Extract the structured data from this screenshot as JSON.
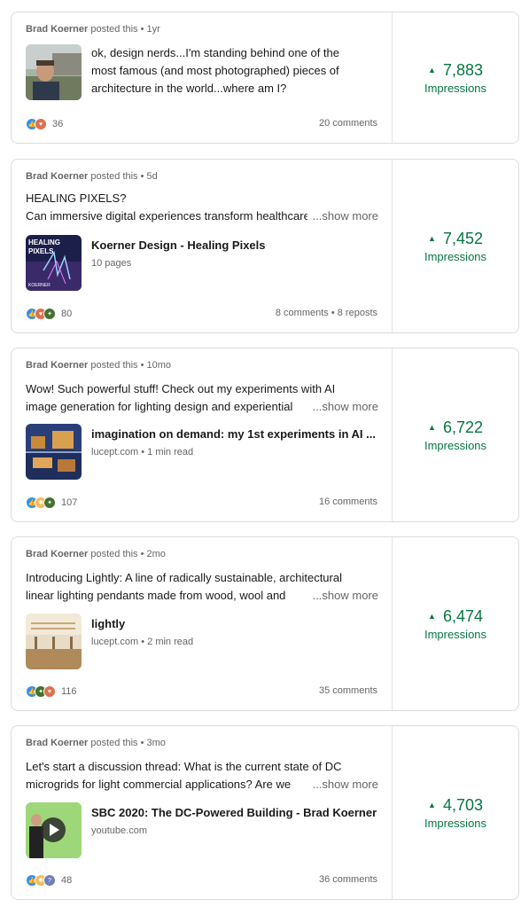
{
  "posts": [
    {
      "author": "Brad Koerner",
      "posted": "posted this • 1yr",
      "lines": [
        "ok, design nerds...I'm standing behind one of the",
        "most famous (and most photographed) pieces of",
        "architecture in the world...where am I?"
      ],
      "reactions": [
        "like",
        "love"
      ],
      "reaction_count": "36",
      "stats": "20 comments",
      "impressions": "7,883",
      "impressions_label": "Impressions"
    },
    {
      "author": "Brad Koerner",
      "posted": "posted this • 5d",
      "line1": "HEALING PIXELS?",
      "line2": "Can immersive digital experiences transform healthcare",
      "show_more": "...show more",
      "thumb_text": [
        "HEALING",
        "PIXELS",
        "KOERNER"
      ],
      "attachment_title": "Koerner Design - Healing Pixels",
      "attachment_sub": "10 pages",
      "reactions": [
        "like",
        "love",
        "celebrate"
      ],
      "reaction_count": "80",
      "stats": "8 comments • 8 reposts",
      "impressions": "7,452",
      "impressions_label": "Impressions"
    },
    {
      "author": "Brad Koerner",
      "posted": "posted this • 10mo",
      "line1": "Wow! Such powerful stuff! Check out my experiments with AI",
      "line2": "image generation for lighting design and experiential",
      "show_more": "...show more",
      "attachment_title": "imagination on demand: my 1st experiments in AI ...",
      "attachment_sub": "lucept.com • 1 min read",
      "reactions": [
        "like",
        "insight",
        "celebrate"
      ],
      "reaction_count": "107",
      "stats": "16 comments",
      "impressions": "6,722",
      "impressions_label": "Impressions"
    },
    {
      "author": "Brad Koerner",
      "posted": "posted this • 2mo",
      "line1": "Introducing Lightly: A line of radically sustainable, architectural",
      "line2": "linear lighting pendants made from wood, wool and",
      "show_more": "...show more",
      "attachment_title": "lightly",
      "attachment_sub": "lucept.com • 2 min read",
      "reactions": [
        "like",
        "celebrate",
        "love"
      ],
      "reaction_count": "116",
      "stats": "35 comments",
      "impressions": "6,474",
      "impressions_label": "Impressions"
    },
    {
      "author": "Brad Koerner",
      "posted": "posted this • 3mo",
      "line1": "Let's start a discussion thread: What is the current state of DC",
      "line2": "microgrids for light commercial applications? Are we",
      "show_more": "...show more",
      "attachment_title": "SBC 2020: The DC-Powered Building - Brad Koerner",
      "attachment_sub": "youtube.com",
      "reactions": [
        "like",
        "insight",
        "curious"
      ],
      "reaction_count": "48",
      "stats": "36 comments",
      "impressions": "4,703",
      "impressions_label": "Impressions"
    }
  ]
}
